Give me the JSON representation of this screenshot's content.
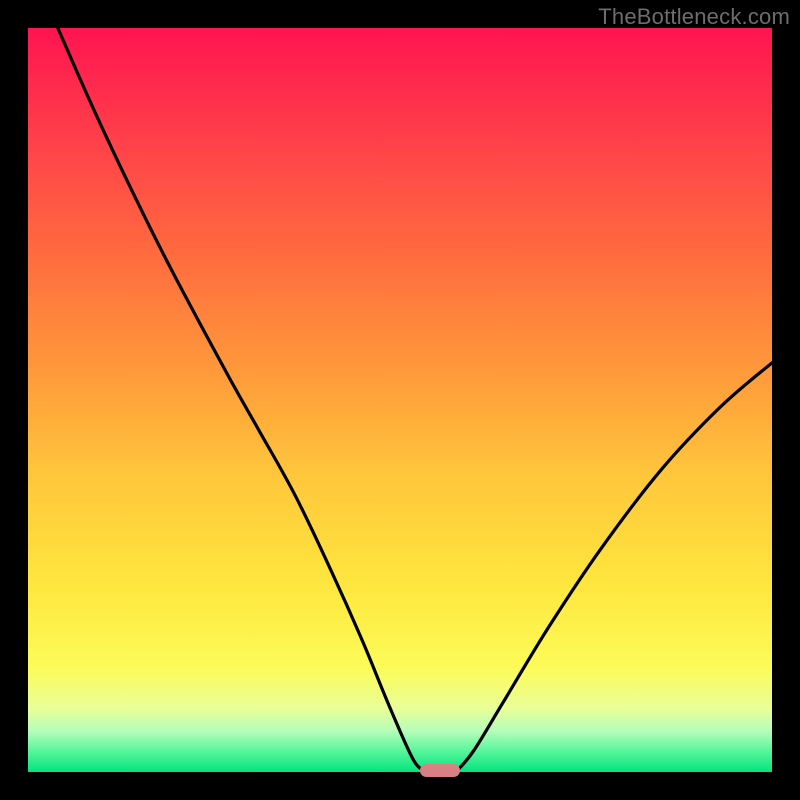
{
  "watermark": "TheBottleneck.com",
  "colors": {
    "frame_bg": "#000000",
    "marker": "#d98084",
    "curve": "#000000"
  },
  "chart_data": {
    "type": "line",
    "title": "",
    "xlabel": "",
    "ylabel": "",
    "xlim": [
      0,
      100
    ],
    "ylim": [
      0,
      100
    ],
    "gradient_stops": [
      {
        "pos": 0,
        "color": "#ff1450"
      },
      {
        "pos": 14,
        "color": "#ff3d4a"
      },
      {
        "pos": 30,
        "color": "#ff6a3f"
      },
      {
        "pos": 45,
        "color": "#ff963a"
      },
      {
        "pos": 60,
        "color": "#ffc63b"
      },
      {
        "pos": 75,
        "color": "#fee73e"
      },
      {
        "pos": 86,
        "color": "#fcfb58"
      },
      {
        "pos": 91.5,
        "color": "#e8fe98"
      },
      {
        "pos": 94.5,
        "color": "#b4feba"
      },
      {
        "pos": 97,
        "color": "#5ef69d"
      },
      {
        "pos": 100,
        "color": "#00e57e"
      }
    ],
    "series": [
      {
        "name": "left-branch",
        "x": [
          4.0,
          10.0,
          18.0,
          26.5,
          31.0,
          36.0,
          41.0,
          45.0,
          48.5,
          51.6,
          53.0
        ],
        "y": [
          100.0,
          86.5,
          70.0,
          54.0,
          46.0,
          37.0,
          26.5,
          17.5,
          9.0,
          2.0,
          0.3
        ]
      },
      {
        "name": "right-branch",
        "x": [
          57.8,
          60.0,
          64.0,
          70.0,
          77.0,
          85.0,
          93.0,
          100.0
        ],
        "y": [
          0.3,
          3.0,
          9.6,
          19.5,
          30.0,
          40.5,
          49.0,
          55.0
        ]
      }
    ],
    "marker": {
      "x_start": 53.0,
      "x_end": 57.8,
      "y": 0.3
    }
  }
}
